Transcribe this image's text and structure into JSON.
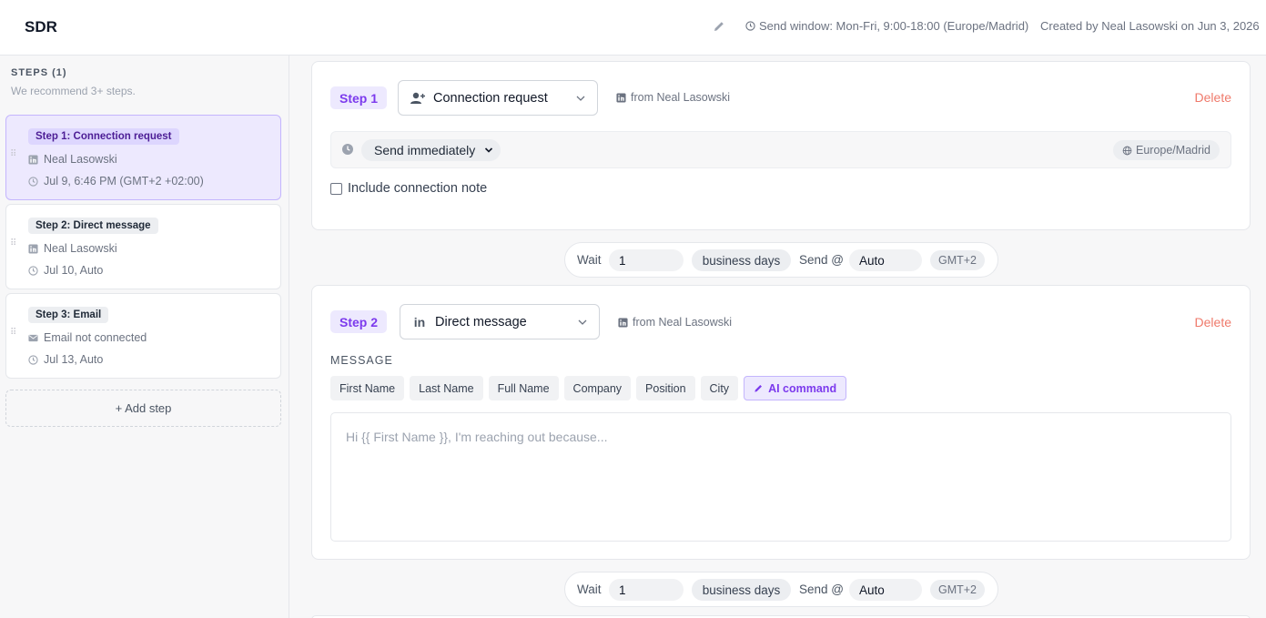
{
  "header": {
    "title": "SDR",
    "send_window": "Send window: Mon-Fri, 9:00-18:00 (Europe/Madrid)",
    "created_by": "Created by Neal Lasowski on Jun 3, 2026"
  },
  "sidebar": {
    "heading": "STEPS (1)",
    "hint": "We recommend 3+ steps.",
    "steps": [
      {
        "title": "Step 1: Connection request",
        "sender": "Neal Lasowski",
        "schedule": "Jul 9, 6:46 PM (GMT+2 +02:00)"
      },
      {
        "title": "Step 2: Direct message",
        "sender": "Neal Lasowski",
        "schedule": "Jul 10, Auto"
      },
      {
        "title": "Step 3: Email",
        "sender": "Email not connected",
        "schedule": "Jul 13, Auto"
      }
    ],
    "add_step": "+ Add step"
  },
  "step1": {
    "pill": "Step 1",
    "type": "Connection request",
    "from": "from Neal Lasowski",
    "delete": "Delete",
    "send_option": "Send immediately",
    "timezone": "Europe/Madrid",
    "note_label": "Include connection note"
  },
  "wait1": {
    "wait_label": "Wait",
    "days_value": "1",
    "days_unit": "business days",
    "send_label": "Send @",
    "send_value": "Auto",
    "tz": "GMT+2"
  },
  "step2": {
    "pill": "Step 2",
    "type": "Direct message",
    "from": "from Neal Lasowski",
    "delete": "Delete",
    "message_label": "MESSAGE",
    "variables": [
      "First Name",
      "Last Name",
      "Full Name",
      "Company",
      "Position",
      "City"
    ],
    "ai_command": "AI command",
    "placeholder": "Hi {{ First Name }}, I'm reaching out because..."
  },
  "wait2": {
    "wait_label": "Wait",
    "days_value": "1",
    "days_unit": "business days",
    "send_label": "Send @",
    "send_value": "Auto",
    "tz": "GMT+2"
  },
  "colors": {
    "accent": "#7c3aed",
    "accent_bg": "#ede9fe",
    "delete": "#ef7a6b"
  }
}
